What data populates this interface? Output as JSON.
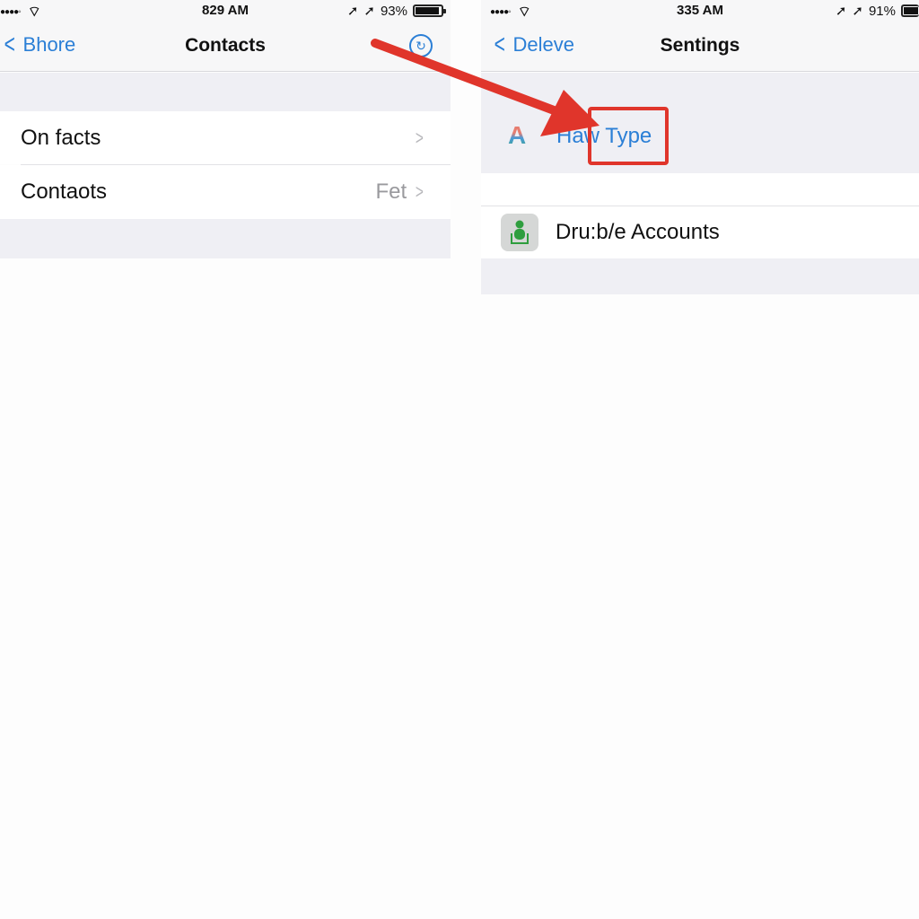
{
  "left_screen": {
    "status_bar": {
      "signal": "●●●●◦",
      "time": "829 AM",
      "battery": "93%",
      "battery_level": 0.93
    },
    "nav": {
      "back_label": "Bhore",
      "title": "Contacts",
      "action_icon": "refresh-icon"
    },
    "rows": [
      {
        "label": "On facts",
        "detail": ""
      },
      {
        "label": "Contaots",
        "detail": "Fet"
      }
    ]
  },
  "right_screen": {
    "status_bar": {
      "signal": "●●●●◦",
      "time": "335 AM",
      "battery": "91%",
      "battery_level": 0.91
    },
    "nav": {
      "back_label": "Deleve",
      "title": "Sentings"
    },
    "highlighted_row": {
      "icon": "font-icon",
      "label": "Haw Type"
    },
    "rows": [
      {
        "icon": "person-download-icon",
        "label": "Dru:b/e Accounts"
      }
    ]
  },
  "annotation": {
    "arrow_color": "#e0352b",
    "box_color": "#e0352b"
  },
  "colors": {
    "accent": "#2b7fd6",
    "group_bg": "#efeff4",
    "cell_bg": "#ffffff"
  }
}
